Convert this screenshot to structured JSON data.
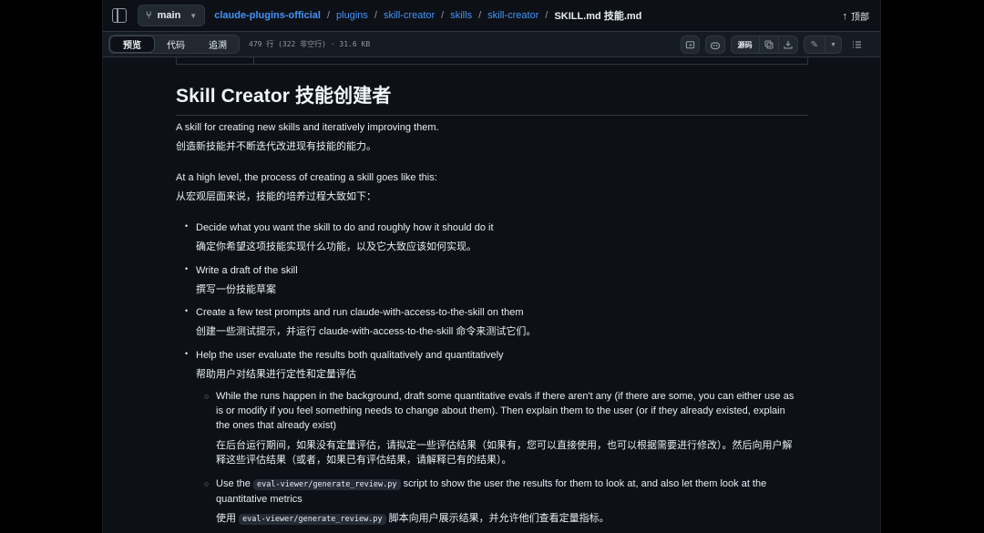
{
  "header": {
    "branch": "main",
    "breadcrumbs": [
      "claude-plugins-official",
      "plugins",
      "skill-creator",
      "skills",
      "skill-creator"
    ],
    "current_file": "SKILL.md  技能.md",
    "top_link": "顶部"
  },
  "toolbar": {
    "tabs": [
      "预览",
      "代码",
      "追溯"
    ],
    "active_tab": "预览",
    "file_info": "479 行 (322 非空行) · 31.6 KB",
    "raw_label": "源码",
    "colors": {
      "accent_link": "#4493f8",
      "bg": "#0d1117"
    }
  },
  "doc": {
    "title": "Skill Creator  技能创建者",
    "intro_en": "A skill for creating new skills and iteratively improving them.",
    "intro_zh": "创造新技能并不断迭代改进现有技能的能力。",
    "overview_en": "At a high level, the process of creating a skill goes like this:",
    "overview_zh": "从宏观层面来说，技能的培养过程大致如下：",
    "steps": [
      {
        "en": "Decide what you want the skill to do and roughly how it should do it",
        "zh": "确定你希望这项技能实现什么功能，以及它大致应该如何实现。"
      },
      {
        "en": "Write a draft of the skill",
        "zh": "撰写一份技能草案"
      },
      {
        "en": "Create a few test prompts and run claude-with-access-to-the-skill on them",
        "zh": "创建一些测试提示，并运行 claude-with-access-to-the-skill 命令来测试它们。"
      },
      {
        "en": "Help the user evaluate the results both qualitatively and quantitatively",
        "zh": "帮助用户对结果进行定性和定量评估"
      }
    ],
    "sub1_en": "While the runs happen in the background, draft some quantitative evals if there aren't any (if there are some, you can either use as is or modify if you feel something needs to change about them). Then explain them to the user (or if they already existed, explain the ones that already exist)",
    "sub1_zh": "在后台运行期间，如果没有定量评估，请拟定一些评估结果（如果有，您可以直接使用，也可以根据需要进行修改）。然后向用户解释这些评估结果（或者，如果已有评估结果，请解释已有的结果）。",
    "sub2_pre": "Use the",
    "sub2_code": "eval-viewer/generate_review.py",
    "sub2_post": "script to show the user the results for them to look at, and also let them look at the quantitative metrics",
    "sub2_zh_pre": "使用",
    "sub2_zh_code": "eval-viewer/generate_review.py",
    "sub2_zh_post": "脚本向用户展示结果，并允许他们查看定量指标。"
  }
}
